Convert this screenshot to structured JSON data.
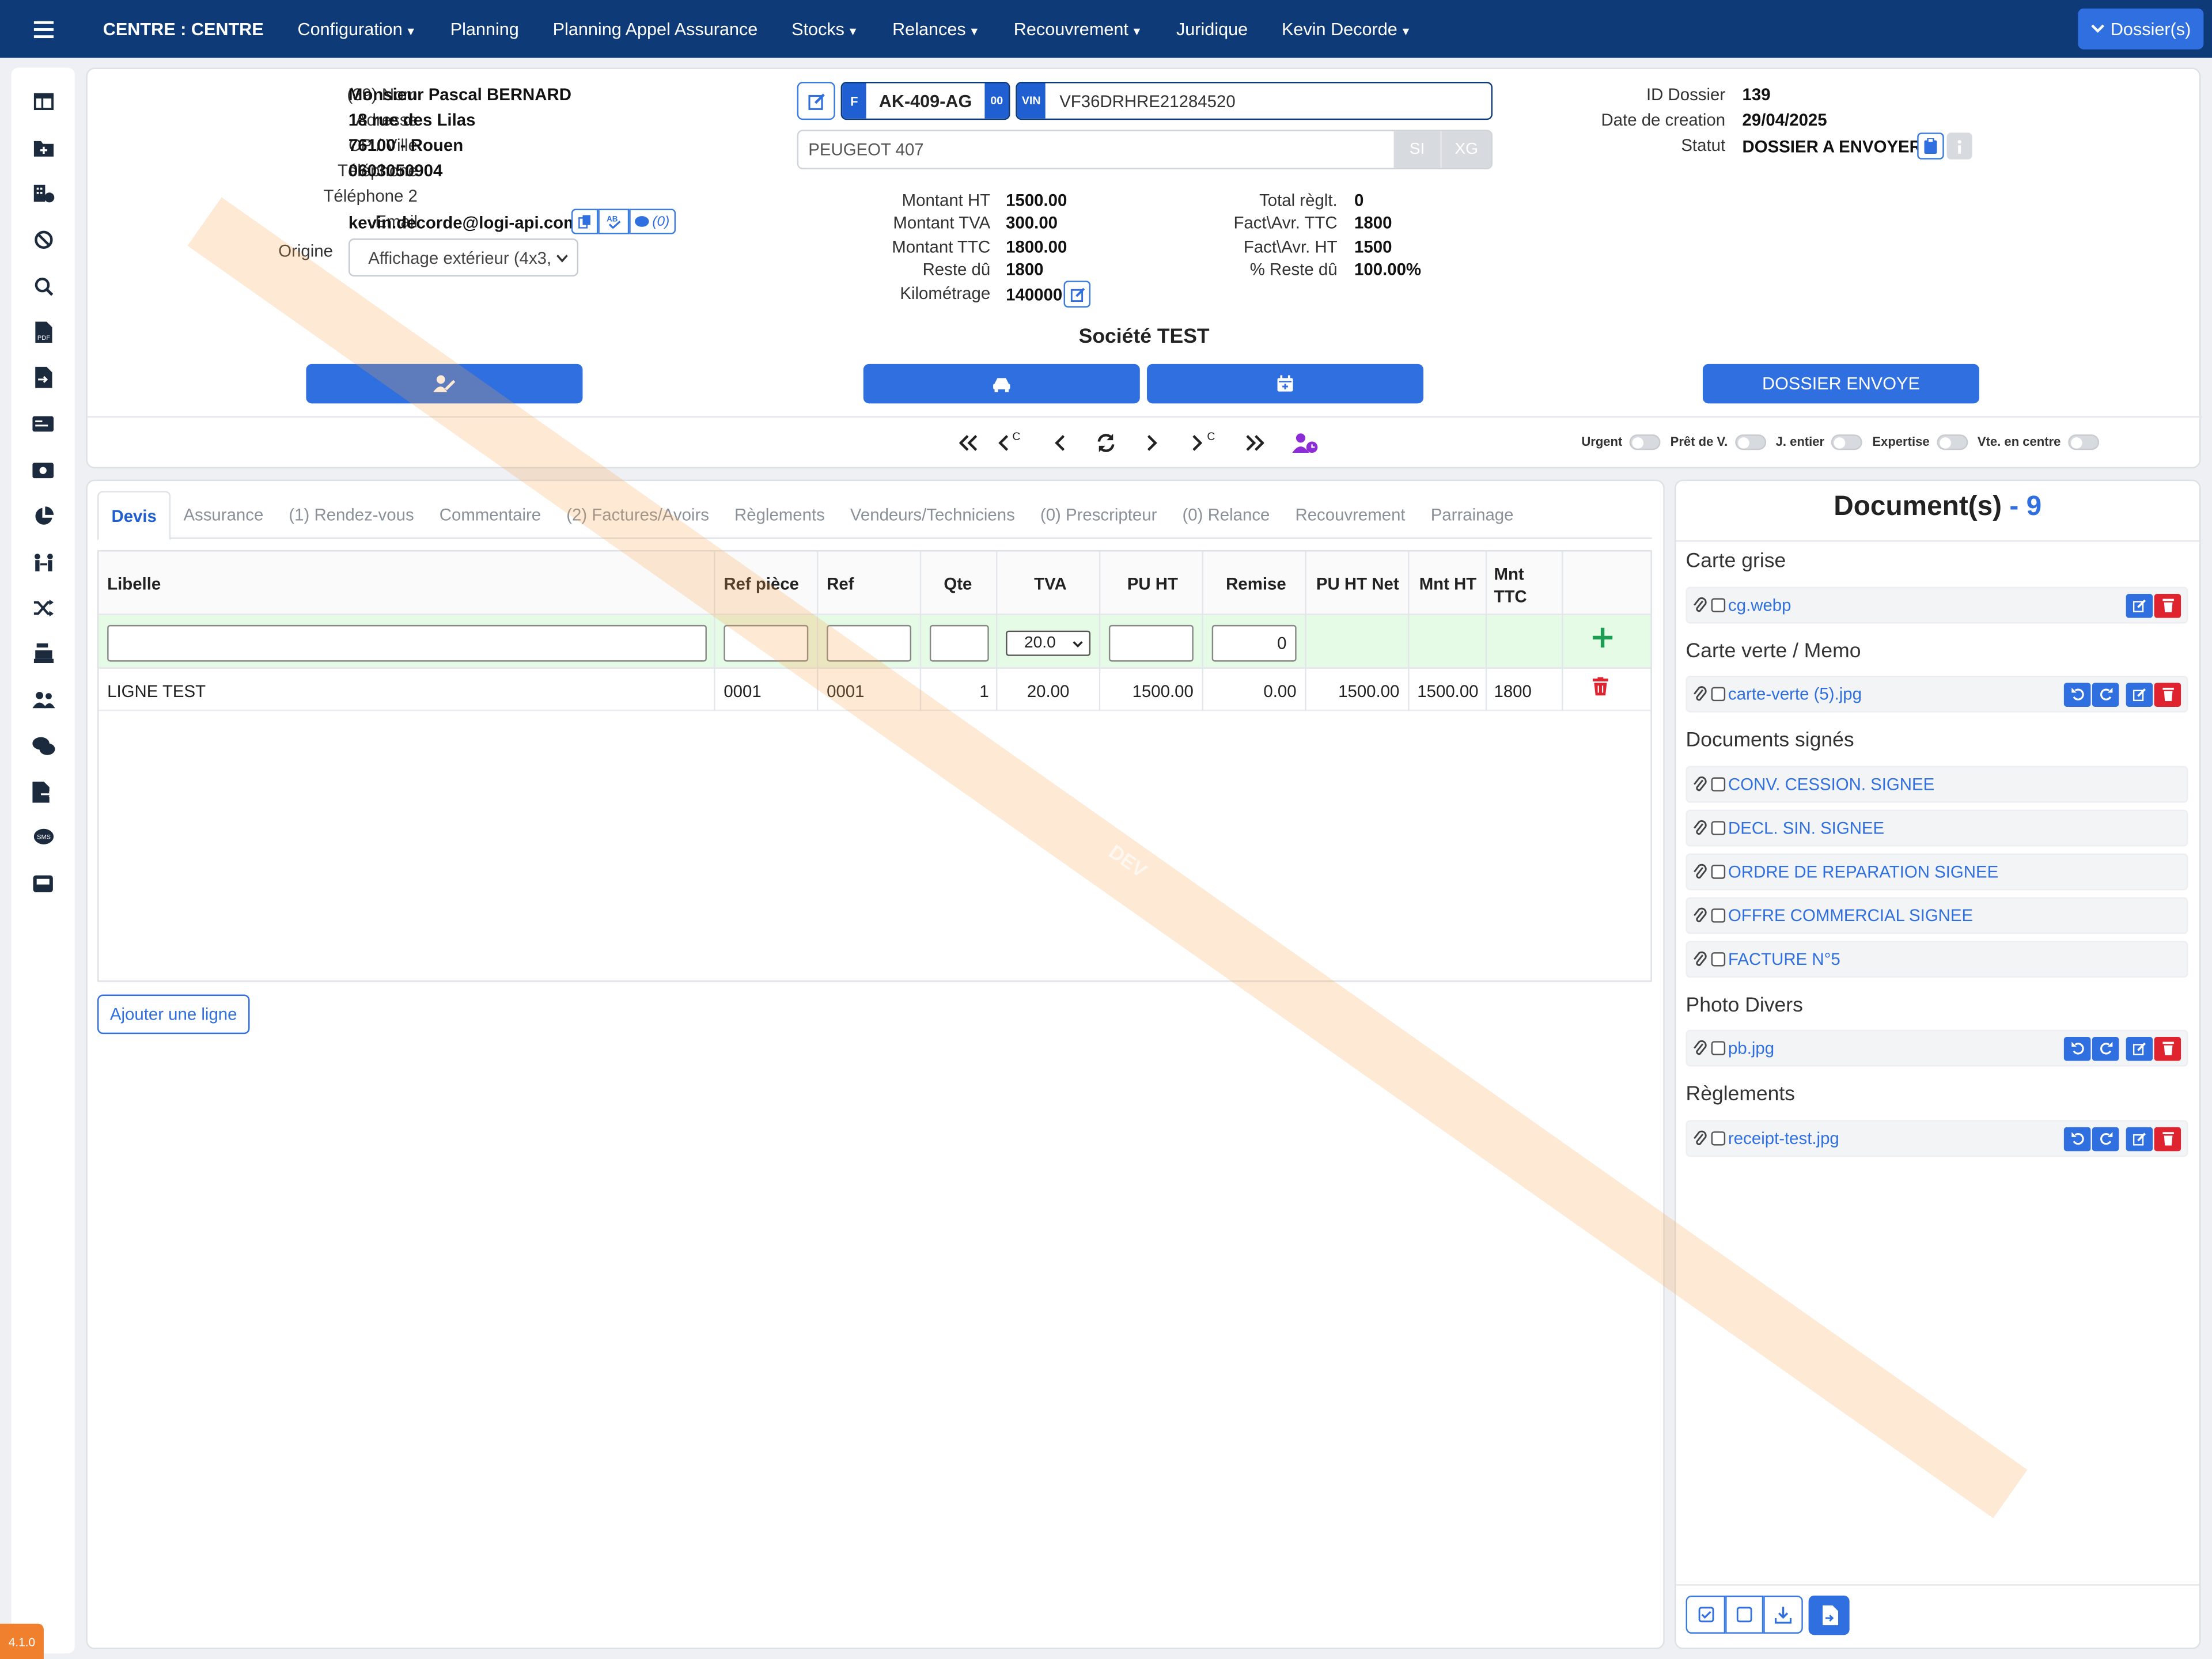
{
  "topbar": {
    "brand": "CENTRE : CENTRE",
    "menu": [
      "Configuration",
      "Planning",
      "Planning Appel Assurance",
      "Stocks",
      "Relances",
      "Recouvrement",
      "Juridique",
      "Kevin Decorde"
    ],
    "dossiers_button": "Dossier(s)"
  },
  "client": {
    "nom_label": "(39) Nom",
    "nom": "Monsieur Pascal BERNARD",
    "adresse_label": "Adresse",
    "adresse": "18 rue des Lilas",
    "cp_label": "CP / Ville",
    "cp": "76100 - Rouen",
    "tel_label": "Téléphone",
    "tel": "0603050904",
    "tel2_label": "Téléphone 2",
    "tel2": "",
    "email_label": "Email",
    "email": "kevin.decorde@logi-api.com",
    "email_count": "(0)",
    "origine_label": "Origine",
    "origine": "Affichage extérieur (4x3,"
  },
  "vehicle": {
    "f_badge": "F",
    "plate": "AK-409-AG",
    "plate_suffix": "00",
    "vin_badge": "VIN",
    "vin": "VF36DRHRE21284520",
    "model": "PEUGEOT 407",
    "si": "SI",
    "xg": "XG"
  },
  "amounts": {
    "ht_label": "Montant HT",
    "ht": "1500.00",
    "tva_label": "Montant TVA",
    "tva": "300.00",
    "ttc_label": "Montant TTC",
    "ttc": "1800.00",
    "reste_label": "Reste dû",
    "reste": "1800",
    "km_label": "Kilométrage",
    "km": "140000",
    "total_label": "Total règlt.",
    "total": "0",
    "factttc_label": "Fact\\Avr. TTC",
    "factttc": "1800",
    "factht_label": "Fact\\Avr. HT",
    "factht": "1500",
    "pct_label": "% Reste dû",
    "pct": "100.00%"
  },
  "company": "Société TEST",
  "dossier": {
    "id_label": "ID Dossier",
    "id": "139",
    "date_label": "Date de creation",
    "date": "29/04/2025",
    "statut_label": "Statut",
    "statut": "DOSSIER A ENVOYER",
    "envoye_button": "DOSSIER ENVOYE"
  },
  "flags": [
    "Urgent",
    "Prêt de V.",
    "J. entier",
    "Expertise",
    "Vte. en centre"
  ],
  "nav_c": "C",
  "tabs": [
    "Devis",
    "Assurance",
    "(1) Rendez-vous",
    "Commentaire",
    "(2) Factures/Avoirs",
    "Règlements",
    "Vendeurs/Techniciens",
    "(0) Prescripteur",
    "(0) Relance",
    "Recouvrement",
    "Parrainage"
  ],
  "table": {
    "headers": [
      "Libelle",
      "Ref pièce",
      "Ref",
      "Qte",
      "TVA",
      "PU HT",
      "Remise",
      "PU HT Net",
      "Mnt HT",
      "Mnt TTC"
    ],
    "tva_select": "20.0",
    "remise_default": "0",
    "rows": [
      {
        "libelle": "LIGNE TEST",
        "ref_piece": "0001",
        "ref": "0001",
        "qte": "1",
        "tva": "20.00",
        "pu_ht": "1500.00",
        "remise": "0.00",
        "pu_ht_net": "1500.00",
        "mnt_ht": "1500.00",
        "mnt_ttc": "1800"
      }
    ],
    "add_line": "Ajouter une ligne"
  },
  "documents": {
    "title": "Document(s)",
    "sep": "-",
    "count": "9",
    "sections": [
      {
        "name": "Carte grise",
        "files": [
          "cg.webp"
        ]
      },
      {
        "name": "Carte verte / Memo",
        "files": [
          "carte-verte (5).jpg"
        ]
      },
      {
        "name": "Documents signés",
        "files": [
          "CONV. CESSION. SIGNEE",
          "DECL. SIN. SIGNEE",
          "ORDRE DE REPARATION SIGNEE",
          "OFFRE COMMERCIAL SIGNEE",
          "FACTURE N°5"
        ]
      },
      {
        "name": "Photo Divers",
        "files": [
          "pb.jpg"
        ]
      },
      {
        "name": "Règlements",
        "files": [
          "receipt-test.jpg"
        ]
      }
    ]
  },
  "watermark": "DEV",
  "version": "4.1.0",
  "colors": {
    "navbar": "#0f3a78",
    "primary": "#2f6fe0",
    "danger": "#e0242f",
    "success": "#1f9d55",
    "watermark": "#f7a24a"
  }
}
